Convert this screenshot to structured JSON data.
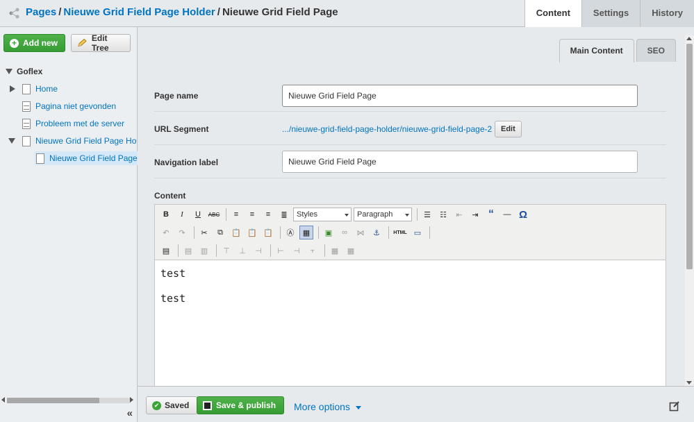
{
  "header": {
    "breadcrumbs": [
      "Pages",
      "Nieuwe Grid Field Page Holder"
    ],
    "current_page": "Nieuwe Grid Field Page",
    "separator": "/",
    "tabs": [
      "Content",
      "Settings",
      "History"
    ]
  },
  "left_panel": {
    "add_new_label": "Add new",
    "edit_tree_label": "Edit Tree",
    "tree": [
      {
        "label": "Goflex"
      },
      {
        "label": "Home"
      },
      {
        "label": "Pagina niet gevonden"
      },
      {
        "label": "Probleem met de server"
      },
      {
        "label": "Nieuwe Grid Field Page Ho"
      },
      {
        "label": "Nieuwe Grid Field Page"
      }
    ],
    "collapse_label": "«"
  },
  "main": {
    "subtabs": [
      "Main Content",
      "SEO"
    ],
    "fields": {
      "page_name_label": "Page name",
      "page_name_value": "Nieuwe Grid Field Page",
      "url_label": "URL Segment",
      "url_value": ".../nieuwe-grid-field-page-holder/nieuwe-grid-field-page-2",
      "url_edit_label": "Edit",
      "nav_label": "Navigation label",
      "nav_value": "Nieuwe Grid Field Page",
      "content_label": "Content"
    },
    "editor": {
      "styles_select": "Styles",
      "format_select": "Paragraph",
      "html_button": "HTML",
      "paragraphs": [
        "test",
        "test"
      ]
    },
    "actions": {
      "saved_label": "Saved",
      "publish_label": "Save & publish",
      "more_options_label": "More options"
    }
  }
}
